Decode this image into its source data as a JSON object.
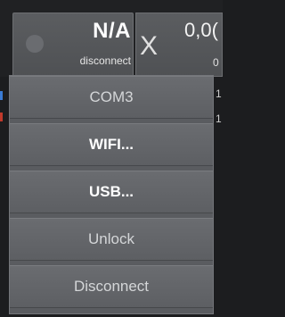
{
  "connection": {
    "value": "N/A",
    "status": "disconnect"
  },
  "axis": {
    "label": "X",
    "value": "0,0(",
    "sub": "0"
  },
  "dropdown": {
    "items": [
      {
        "label": "COM3"
      },
      {
        "label": "WIFI..."
      },
      {
        "label": "USB..."
      },
      {
        "label": "Unlock"
      },
      {
        "label": "Disconnect"
      }
    ]
  },
  "colors": {
    "background": "#1c1d1f",
    "panel": "#56585b",
    "menu_item": "#64666a",
    "text_primary": "#ffffff",
    "edge_blue": "#3a7bd5",
    "edge_red": "#c0392b"
  },
  "right_edge_glyphs": [
    "1",
    "1"
  ]
}
